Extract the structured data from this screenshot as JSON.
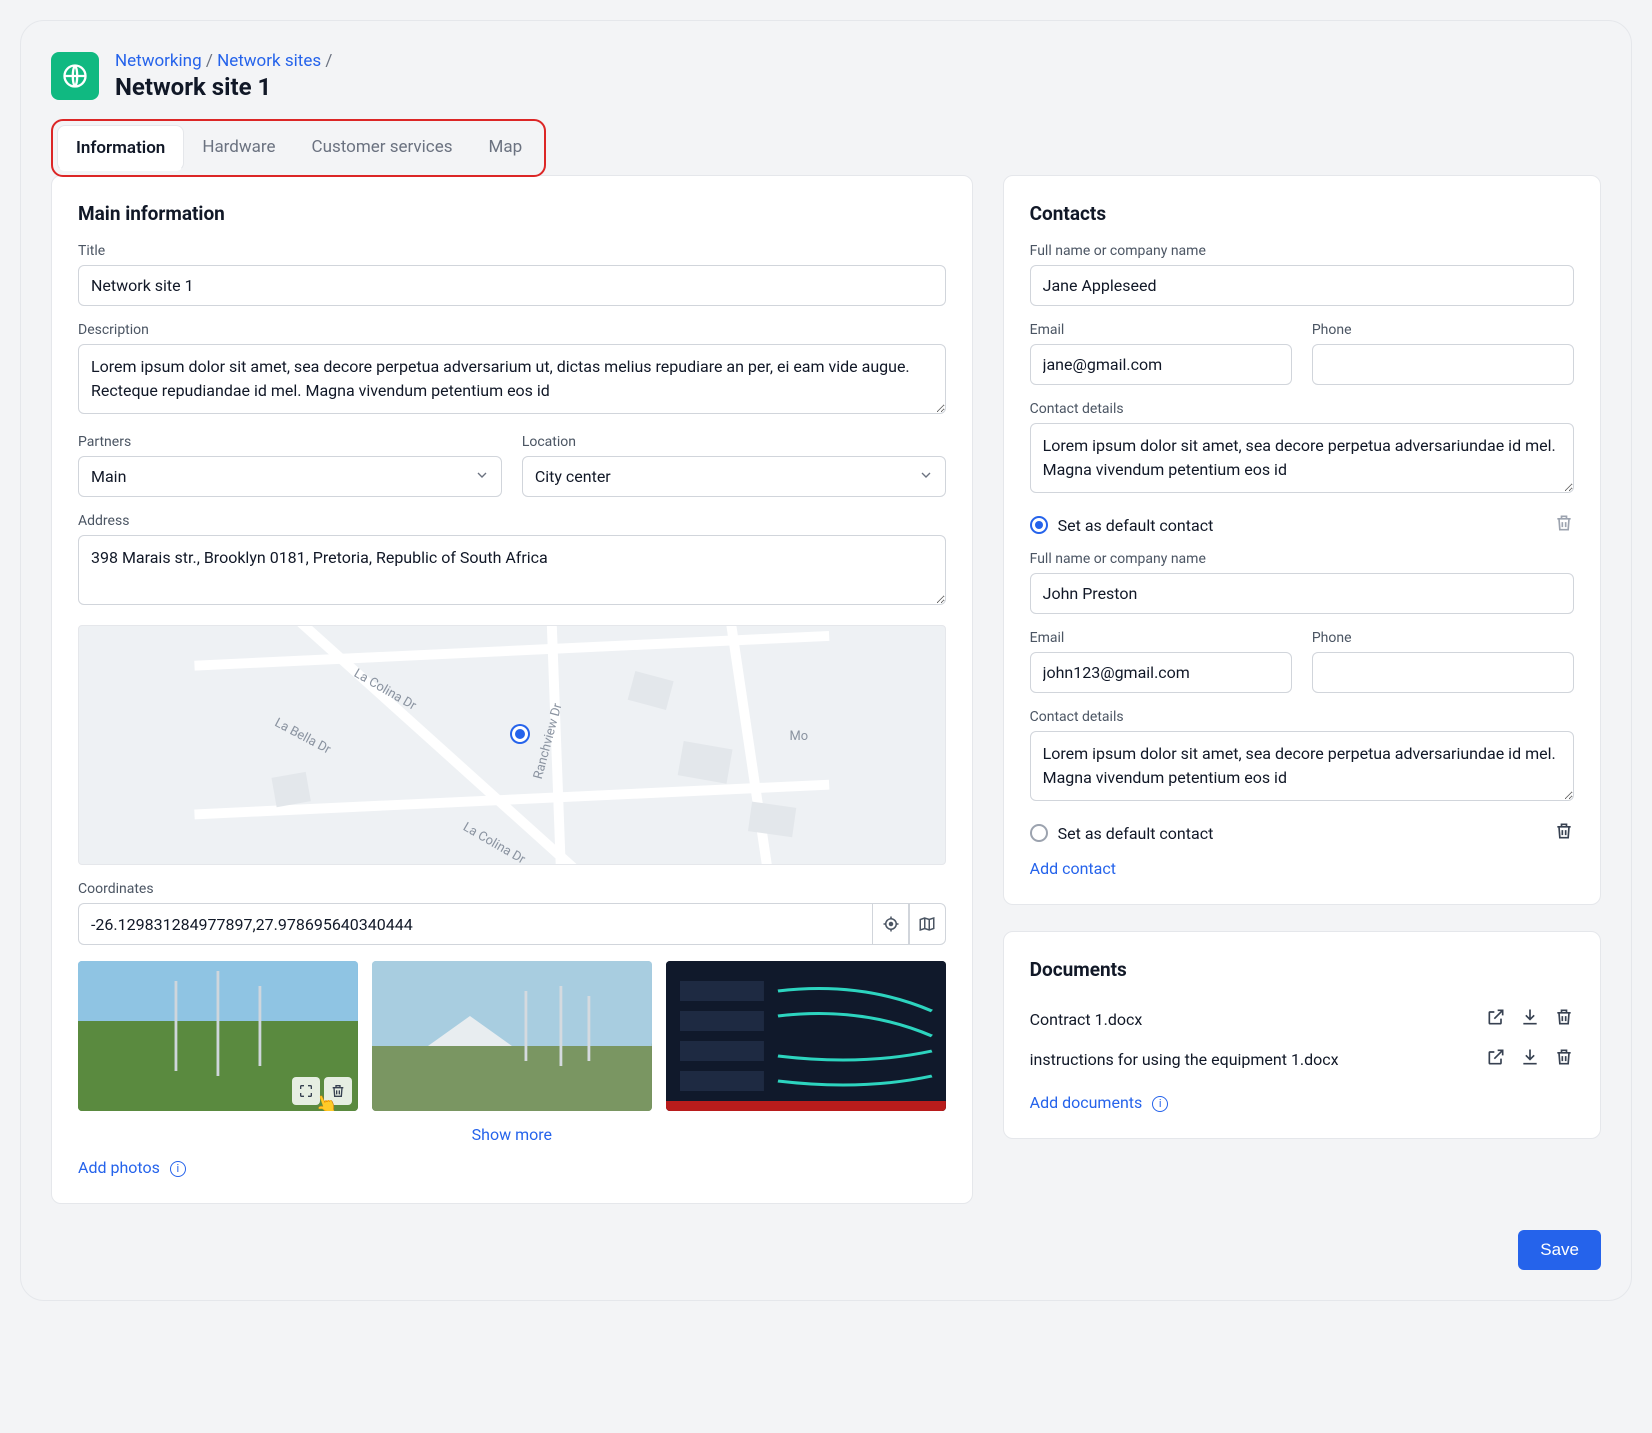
{
  "breadcrumb": {
    "root": "Networking",
    "section": "Network sites"
  },
  "page_title": "Network site 1",
  "tabs": {
    "information": "Information",
    "hardware": "Hardware",
    "customer_services": "Customer services",
    "map": "Map"
  },
  "main": {
    "heading": "Main information",
    "title_label": "Title",
    "title_value": "Network site 1",
    "description_label": "Description",
    "description_value": "Lorem ipsum dolor sit amet, sea decore perpetua adversarium ut, dictas melius repudiare an per, ei eam vide augue. Recteque repudiandae id mel. Magna vivendum petentium eos id",
    "partners_label": "Partners",
    "partners_value": "Main",
    "location_label": "Location",
    "location_value": "City center",
    "address_label": "Address",
    "address_value": "398 Marais str., Brooklyn 0181, Pretoria, Republic of South Africa",
    "coordinates_label": "Coordinates",
    "coordinates_value": "-26.129831284977897,27.978695640340444",
    "show_more": "Show more",
    "add_photos": "Add photos",
    "map_streets": [
      "La Bella Dr",
      "La Colina Dr",
      "La Colina Dr",
      "Ranchview Dr",
      "Mo"
    ]
  },
  "contacts": {
    "heading": "Contacts",
    "name_label": "Full name or company name",
    "email_label": "Email",
    "phone_label": "Phone",
    "details_label": "Contact details",
    "default_label": "Set as default contact",
    "add_contact": "Add contact",
    "items": [
      {
        "name": "Jane Appleseed",
        "email": "jane@gmail.com",
        "phone": "",
        "details": "Lorem ipsum dolor sit amet, sea decore perpetua adversariundae id mel. Magna vivendum petentium eos id",
        "default": true
      },
      {
        "name": "John Preston",
        "email": "john123@gmail.com",
        "phone": "",
        "details": "Lorem ipsum dolor sit amet, sea decore perpetua adversariundae id mel. Magna vivendum petentium eos id",
        "default": false
      }
    ]
  },
  "documents": {
    "heading": "Documents",
    "add_documents": "Add documents",
    "items": [
      "Contract 1.docx",
      "instructions for using the equipment 1.docx"
    ]
  },
  "save_label": "Save"
}
